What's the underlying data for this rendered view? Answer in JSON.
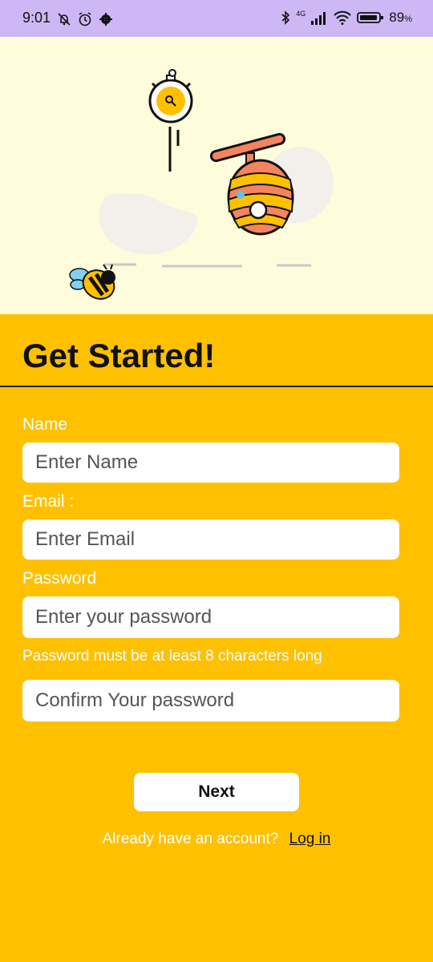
{
  "status_bar": {
    "time": "9:01",
    "network": "4G",
    "battery": "89",
    "battery_unit": "%"
  },
  "hero": {
    "illustration": "bee-hive-stopwatch-illustration"
  },
  "form": {
    "title": "Get Started!",
    "name_label": "Name",
    "name_placeholder": "Enter Name",
    "email_label": "Email :",
    "email_placeholder": "Enter Email",
    "password_label": "Password",
    "password_placeholder": "Enter your password",
    "password_hint": "Password must be at least 8 characters long",
    "confirm_placeholder": "Confirm Your password",
    "next_label": "Next",
    "login_prompt": "Already have an account?",
    "login_link": "Log in"
  },
  "colors": {
    "accent": "#FFC000",
    "hero_bg": "#FFFCDC",
    "status_bg": "#CDB8F5",
    "hive": "#F4845F"
  }
}
